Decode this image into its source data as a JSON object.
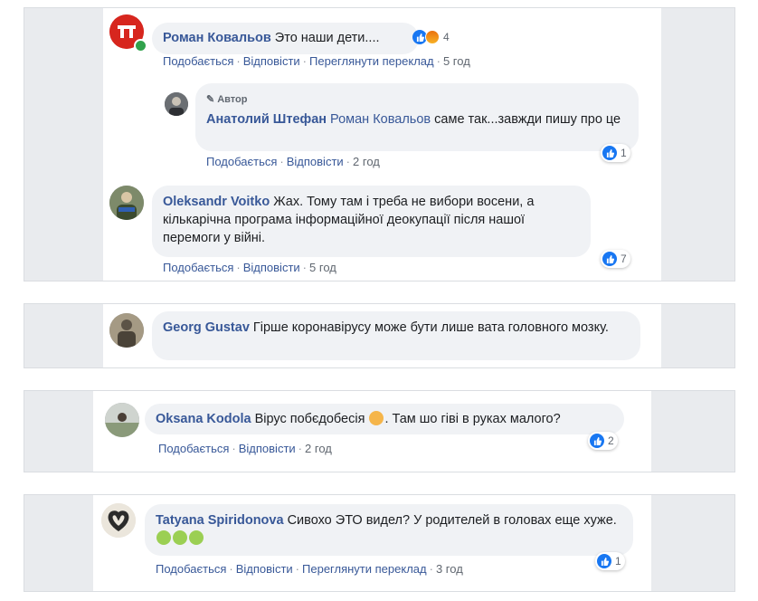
{
  "thread1": {
    "comment1": {
      "author": "Роман Ковальов",
      "text": "Это наши дети....",
      "reaction_count": "4",
      "actions": {
        "like": "Подобається",
        "reply": "Відповісти",
        "translate": "Переглянути переклад",
        "time": "5 год"
      }
    },
    "reply1": {
      "badge": "Автор",
      "author": "Анатолий Штефан",
      "mention": "Роман Ковальов",
      "text": "саме так...завжди пишу про це",
      "reaction_count": "1",
      "actions": {
        "like": "Подобається",
        "reply": "Відповісти",
        "time": "2 год"
      }
    },
    "comment2": {
      "author": "Oleksandr Voitko",
      "text": "Жах. Тому там і треба не вибори восени, а кількарічна програма інформаційної деокупації після нашої перемоги у війні.",
      "reaction_count": "7",
      "actions": {
        "like": "Подобається",
        "reply": "Відповісти",
        "time": "5 год"
      }
    }
  },
  "comment3": {
    "author": "Georg Gustav",
    "text": "Гірше коронавірусу може бути лише вата головного мозку."
  },
  "comment4": {
    "author": "Oksana Kodola",
    "text_before": "Вірус побєдобесія",
    "text_after": ". Там шо гіві в руках малого?",
    "reaction_count": "2",
    "actions": {
      "like": "Подобається",
      "reply": "Відповісти",
      "time": "2 год"
    }
  },
  "comment5": {
    "author": "Tatyana Spiridonova",
    "text": "Сивохо ЭТО видел? У родителей в головах еще хуже.",
    "reaction_count": "1",
    "actions": {
      "like": "Подобається",
      "reply": "Відповісти",
      "translate": "Переглянути переклад",
      "time": "3 год"
    }
  },
  "colors": {
    "link": "#385898",
    "like": "#1877f2",
    "bubble": "#f0f2f5",
    "panel": "#e9ebee"
  },
  "separator": "·"
}
